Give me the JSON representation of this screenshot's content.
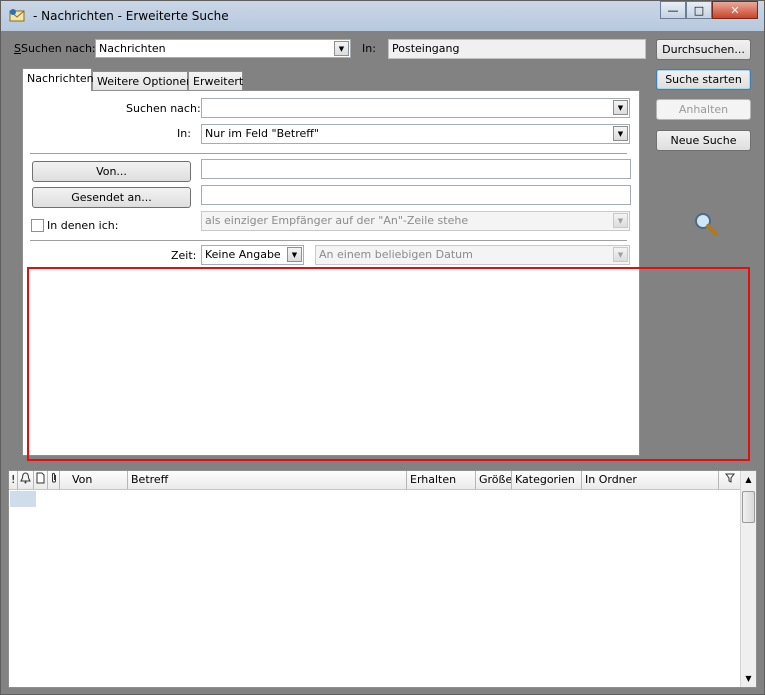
{
  "window": {
    "title": "- Nachrichten - Erweiterte Suche",
    "minimize": "—",
    "maximize": "□",
    "close": "✕"
  },
  "top": {
    "search_for_label": "Suchen nach:",
    "search_for_value": "Nachrichten",
    "in_label": "In:",
    "in_value": "Posteingang"
  },
  "buttons": {
    "browse": "Durchsuchen...",
    "start": "Suche starten",
    "stop": "Anhalten",
    "new": "Neue Suche"
  },
  "tabs": [
    "Nachrichten",
    "Weitere Optionen",
    "Erweitert"
  ],
  "form": {
    "search_label": "Suchen nach:",
    "search_value": "",
    "in_label": "In:",
    "in_value": "Nur im Feld \"Betreff\"",
    "from_button": "Von...",
    "from_value": "",
    "sent_to_button": "Gesendet an...",
    "sent_to_value": "",
    "where_i_am_label": "In denen ich:",
    "where_i_am_value": "als einziger Empfänger auf der \"An\"-Zeile stehe",
    "time_label": "Zeit:",
    "time_value": "Keine Angabe",
    "date_value": "An einem beliebigen Datum"
  },
  "columns": [
    "!",
    "",
    "",
    "",
    "Von",
    "Betreff",
    "Erhalten",
    "Größe",
    "Kategorien",
    "In Ordner"
  ],
  "colors": {
    "highlight_border": "#e01010",
    "background": "#828282"
  }
}
